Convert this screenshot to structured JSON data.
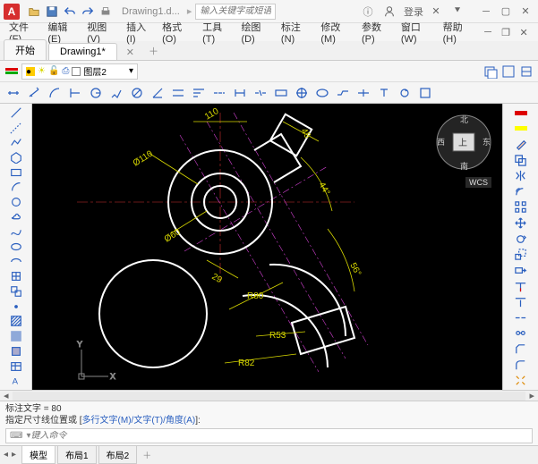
{
  "app": {
    "icon_letter": "A",
    "doc_name": "Drawing1.d...",
    "search_placeholder": "输入关键字或短语",
    "user_label": "登录"
  },
  "menu": {
    "file": "文件(F)",
    "edit": "编辑(E)",
    "view": "视图(V)",
    "insert": "插入(I)",
    "format": "格式(O)",
    "tools": "工具(T)",
    "draw": "绘图(D)",
    "dim": "标注(N)",
    "modify": "修改(M)",
    "param": "参数(P)",
    "window": "窗口(W)",
    "help": "帮助(H)"
  },
  "tabs": {
    "start": "开始",
    "drawing": "Drawing1*"
  },
  "layer": {
    "current": "图层2"
  },
  "dims": {
    "d110": "Ø110",
    "d60": "Ø60",
    "a44": "44°",
    "a56": "56°",
    "d110t": "110",
    "d45": "45",
    "d29": "29",
    "r80": "R80",
    "r53": "R53",
    "r82": "R82"
  },
  "cube": {
    "n": "北",
    "s": "南",
    "e": "东",
    "w": "西",
    "top": "上",
    "wcs": "WCS"
  },
  "cmd": {
    "line1": "标注文字 = 80",
    "line2_a": "指定尺寸线位置或 [",
    "line2_b": "多行文字(M)/文字(T)/角度(A)",
    "line2_c": "]:",
    "prompt_icon": "⌨",
    "input_placeholder": "键入命令"
  },
  "btabs": {
    "model": "模型",
    "layout1": "布局1",
    "layout2": "布局2"
  },
  "ucs": {
    "x": "X",
    "y": "Y"
  }
}
